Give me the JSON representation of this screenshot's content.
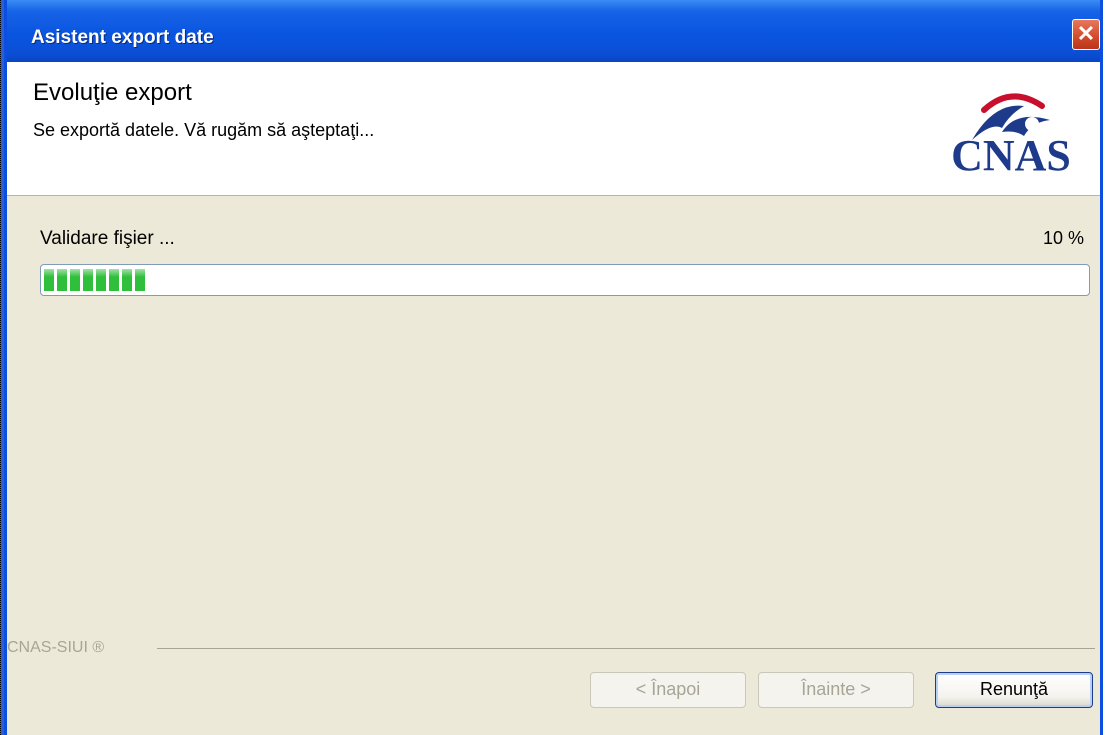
{
  "window": {
    "title": "Asistent export date",
    "close_glyph": "✕"
  },
  "header": {
    "heading": "Evoluţie export",
    "subheading": "Se exportă datele. Vă rugăm să aşteptaţi...",
    "logo_text": "CNAS"
  },
  "progress": {
    "status": "Validare fişier ...",
    "percent_label": "10 %",
    "fraction": 0.1
  },
  "footer": {
    "brand": "CNAS-SIUI ®"
  },
  "buttons": {
    "back": "< Înapoi",
    "next": "Înainte >",
    "cancel": "Renunţă"
  },
  "colors": {
    "title_bar": "#0a55e0",
    "progress_fill": "#2fbf3a",
    "logo_blue": "#1e3a8a",
    "logo_red": "#c8102e"
  }
}
